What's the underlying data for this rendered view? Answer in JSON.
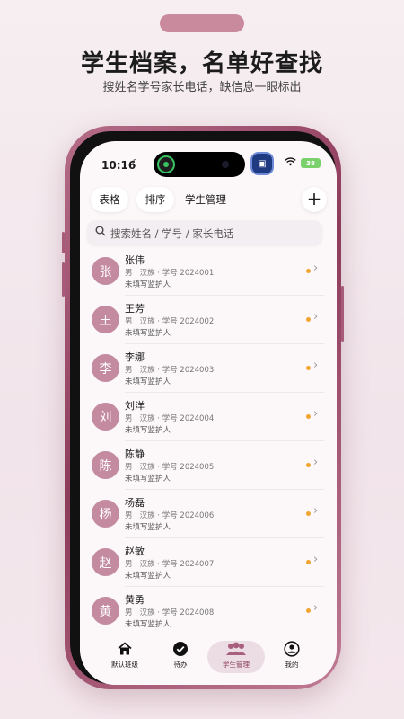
{
  "hero": {
    "title": "学生档案，名单好查找",
    "subtitle": "搜姓名学号家长电话，缺信息一眼标出"
  },
  "status_bar": {
    "time": "10:16",
    "battery": "38"
  },
  "toolbar": {
    "chip_table": "表格",
    "chip_sort": "排序",
    "chip_student_mgmt": "学生管理",
    "add_label": "+"
  },
  "search": {
    "placeholder": "搜索姓名 / 学号 / 家长电话"
  },
  "students": [
    {
      "initial": "张",
      "name": "张伟",
      "meta": "男 · 汉族 · 学号 2024001",
      "guardian": "未填写监护人"
    },
    {
      "initial": "王",
      "name": "王芳",
      "meta": "男 · 汉族 · 学号 2024002",
      "guardian": "未填写监护人"
    },
    {
      "initial": "李",
      "name": "李娜",
      "meta": "男 · 汉族 · 学号 2024003",
      "guardian": "未填写监护人"
    },
    {
      "initial": "刘",
      "name": "刘洋",
      "meta": "男 · 汉族 · 学号 2024004",
      "guardian": "未填写监护人"
    },
    {
      "initial": "陈",
      "name": "陈静",
      "meta": "男 · 汉族 · 学号 2024005",
      "guardian": "未填写监护人"
    },
    {
      "initial": "杨",
      "name": "杨磊",
      "meta": "男 · 汉族 · 学号 2024006",
      "guardian": "未填写监护人"
    },
    {
      "initial": "赵",
      "name": "赵敏",
      "meta": "男 · 汉族 · 学号 2024007",
      "guardian": "未填写监护人"
    },
    {
      "initial": "黄",
      "name": "黄勇",
      "meta": "男 · 汉族 · 学号 2024008",
      "guardian": "未填写监护人"
    }
  ],
  "tabbar": {
    "tabs": [
      {
        "label": "默认班级",
        "icon": "home-icon"
      },
      {
        "label": "待办",
        "icon": "check-circle-icon"
      },
      {
        "label": "学生管理",
        "icon": "people-icon"
      },
      {
        "label": "我的",
        "icon": "user-icon"
      }
    ],
    "active": "学生管理"
  },
  "colors": {
    "accent": "#c98a9d",
    "avatar": "#c48ba0",
    "missing_dot": "#f0a531",
    "phone_frame": "#8d3b5a"
  }
}
